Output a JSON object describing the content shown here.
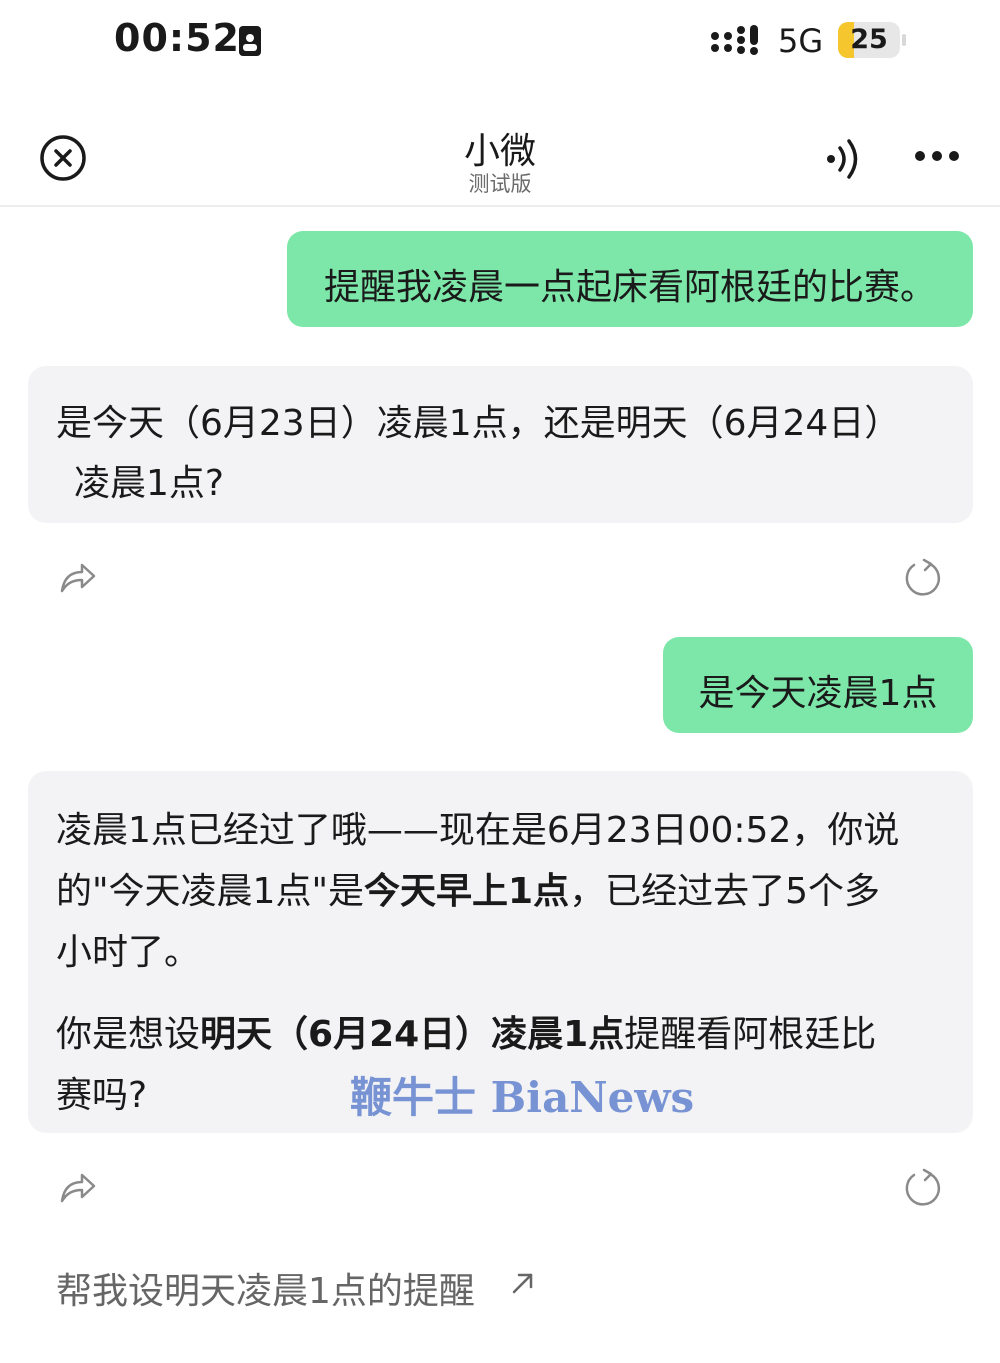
{
  "status_bar": {
    "time": "00:52",
    "network": "5G",
    "battery_level": "25",
    "battery_fraction": 0.25,
    "battery_color": "#f5c62e"
  },
  "nav": {
    "title": "小微",
    "subtitle": "测试版",
    "close_icon": "close-circle-icon",
    "speaker_icon": "speaker-icon",
    "more_icon": "more-dots-icon"
  },
  "messages": {
    "user_1": "提醒我凌晨一点起床看阿根廷的比赛。",
    "bot_1_line1": "是今天（6月23日）凌晨1点，还是明天（6月24日）",
    "bot_1_line2": "凌晨1点?",
    "user_2": "是今天凌晨1点",
    "bot_2": {
      "line1": "凌晨1点已经过了哦——现在是6月23日00:52，你说",
      "line2_a": "的\"今天凌晨1点\"是",
      "line2_b": "今天早上1点",
      "line2_c": "，已经过去了5个多",
      "line3": "小时了。",
      "line4_a": "你是想设",
      "line4_b": "明天（6月24日）凌晨1点",
      "line4_c": "提醒看阿根廷比",
      "line5": "赛吗?"
    }
  },
  "actions": {
    "share_icon": "share-icon",
    "regenerate_icon": "refresh-icon"
  },
  "suggestion": {
    "text": "帮我设明天凌晨1点的提醒",
    "icon": "arrow-up-right-icon"
  },
  "watermark": "鞭牛士 BiaNews",
  "colors": {
    "user_bubble": "#7de7a9",
    "bot_bubble": "#f3f3f5"
  }
}
